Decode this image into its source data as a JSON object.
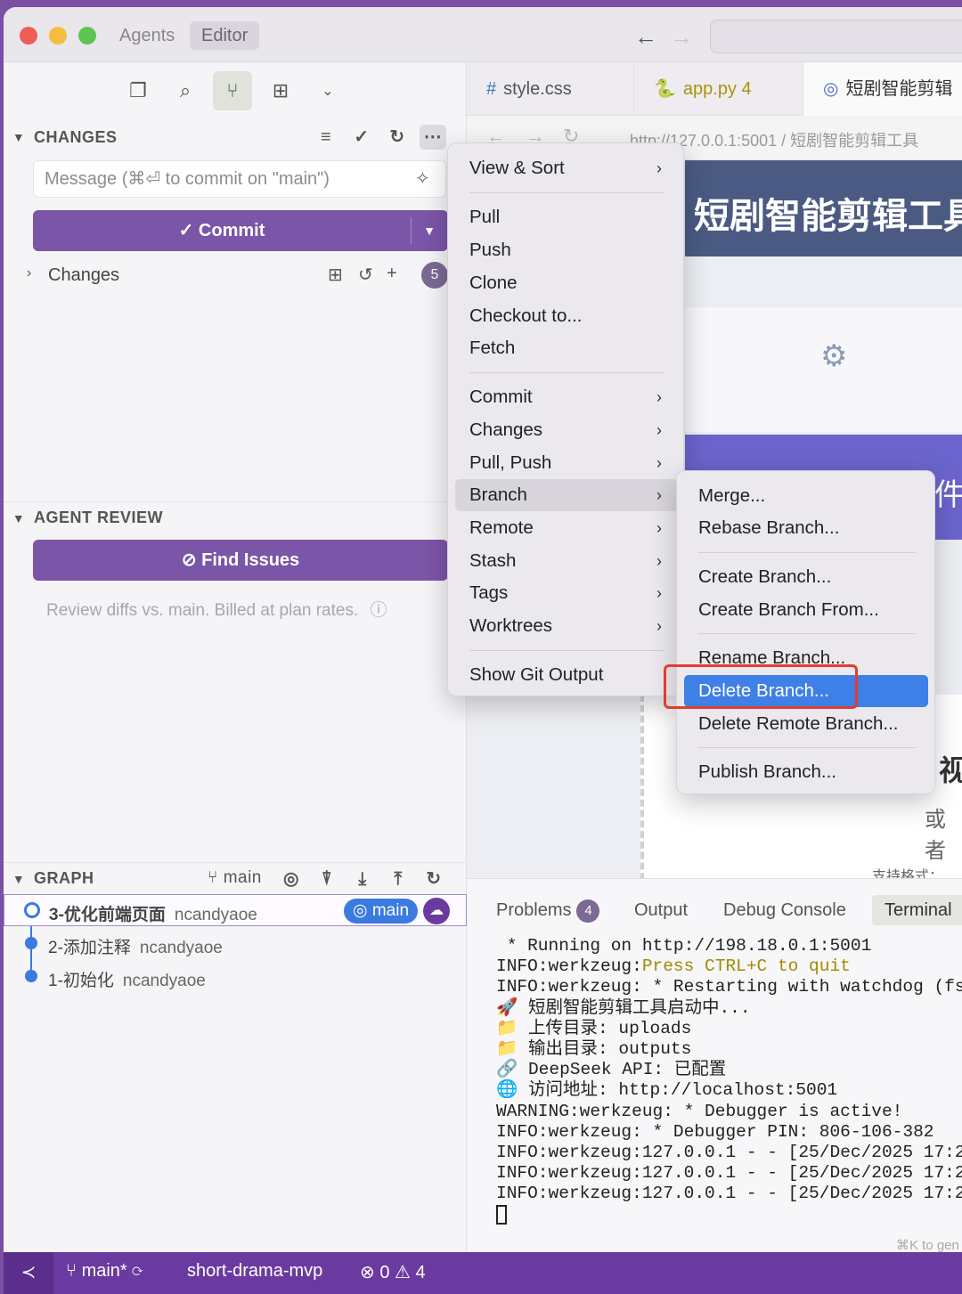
{
  "titlebar": {
    "tabs": [
      "Agents",
      "Editor"
    ],
    "back_arrow": "←",
    "forward_arrow": "→"
  },
  "activity_bar": {
    "icons": [
      "files-icon",
      "search-icon",
      "source-control-icon",
      "extensions-icon",
      "chevron-down-icon"
    ]
  },
  "changes_section": {
    "title": "CHANGES",
    "message_placeholder": "Message (⌘⏎ to commit on \"main\")",
    "commit_label": "✓ Commit",
    "changes_label": "Changes",
    "changes_count": "5"
  },
  "agent_review": {
    "title": "AGENT REVIEW",
    "find_issues_label": "Find Issues",
    "note": "Review diffs vs. main. Billed at plan rates."
  },
  "graph": {
    "title": "GRAPH",
    "branch_label": "main",
    "commits": [
      {
        "message": "3-优化前端页面",
        "author": "ncandyaoe",
        "branch": "main"
      },
      {
        "message": "2-添加注释",
        "author": "ncandyaoe"
      },
      {
        "message": "1-初始化",
        "author": "ncandyaoe"
      }
    ]
  },
  "editor_tabs": [
    {
      "icon": "#",
      "name": "style.css"
    },
    {
      "icon": "🐍",
      "name": "app.py",
      "badge": "4"
    },
    {
      "icon": "◎",
      "name": "短剧智能剪辑"
    }
  ],
  "browser": {
    "url": "http://127.0.0.1:5001 / 短剧智能剪辑工具",
    "banner_title": "短剧智能剪辑工具",
    "purple_text": "件",
    "text1": "视",
    "text2": "或者",
    "text3": "支持格式："
  },
  "panel": {
    "tabs": {
      "problems": "Problems",
      "problems_count": "4",
      "output": "Output",
      "debug": "Debug Console",
      "terminal": "Terminal"
    },
    "terminal_lines": [
      " * Running on http://198.18.0.1:5001",
      "INFO:werkzeug:",
      "INFO:werkzeug: * Restarting with watchdog (fs",
      "🚀 短剧智能剪辑工具启动中...",
      "📁 上传目录: uploads",
      "📁 输出目录: outputs",
      "🔗 DeepSeek API: 已配置",
      "🌐 访问地址: http://localhost:5001",
      "WARNING:werkzeug: * Debugger is active!",
      "INFO:werkzeug: * Debugger PIN: 806-106-382",
      "INFO:werkzeug:127.0.0.1 - - [25/Dec/2025 17:2",
      "INFO:werkzeug:127.0.0.1 - - [25/Dec/2025 17:2",
      "INFO:werkzeug:127.0.0.1 - - [25/Dec/2025 17:2"
    ],
    "quit_hint": "Press CTRL+C to quit",
    "hint": "⌘K to gen"
  },
  "statusbar": {
    "branch": "main*",
    "project": "short-drama-mvp",
    "errors": "0",
    "warnings": "4"
  },
  "menu_main": {
    "items": [
      "View & Sort",
      "Pull",
      "Push",
      "Clone",
      "Checkout to...",
      "Fetch",
      "Commit",
      "Changes",
      "Pull, Push",
      "Branch",
      "Remote",
      "Stash",
      "Tags",
      "Worktrees",
      "Show Git Output"
    ]
  },
  "menu_branch": {
    "items": [
      "Merge...",
      "Rebase Branch...",
      "Create Branch...",
      "Create Branch From...",
      "Rename Branch...",
      "Delete Branch...",
      "Delete Remote Branch...",
      "Publish Branch..."
    ]
  },
  "colors": {
    "accent": "#7b55a8",
    "highlight": "#3f7fe8",
    "callout": "#e53b2f"
  }
}
